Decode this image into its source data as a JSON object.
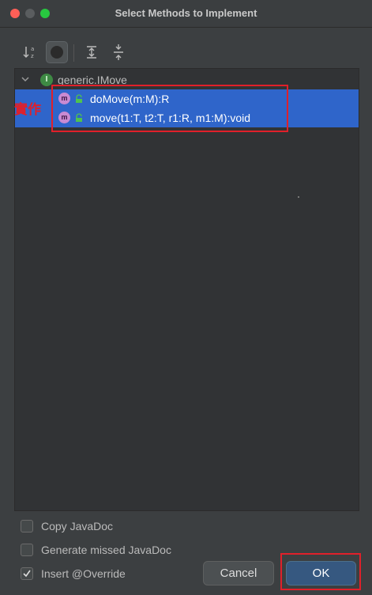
{
  "window": {
    "title": "Select Methods to Implement"
  },
  "toolbar": {
    "sort_icon": "sort-alpha-icon",
    "inherited_icon": "show-inherited-icon",
    "expand_icon": "expand-all-icon",
    "collapse_icon": "collapse-all-icon"
  },
  "tree": {
    "root": {
      "label": "generic.IMove",
      "icon_letter": "I"
    },
    "methods": [
      {
        "label": "doMove(m:M):R",
        "icon_letter": "m",
        "selected": true
      },
      {
        "label": "move(t1:T, t2:T, r1:R, m1:M):void",
        "icon_letter": "m",
        "selected": true
      }
    ]
  },
  "annotation": {
    "text": "實作",
    "color": "#e0202a"
  },
  "options": [
    {
      "label": "Copy JavaDoc",
      "checked": false
    },
    {
      "label": "Generate missed JavaDoc",
      "checked": false
    },
    {
      "label": "Insert @Override",
      "checked": true
    }
  ],
  "buttons": {
    "cancel": "Cancel",
    "ok": "OK"
  },
  "colors": {
    "selection": "#2f65ca",
    "ok_button": "#365880",
    "annotation": "#e0202a"
  }
}
